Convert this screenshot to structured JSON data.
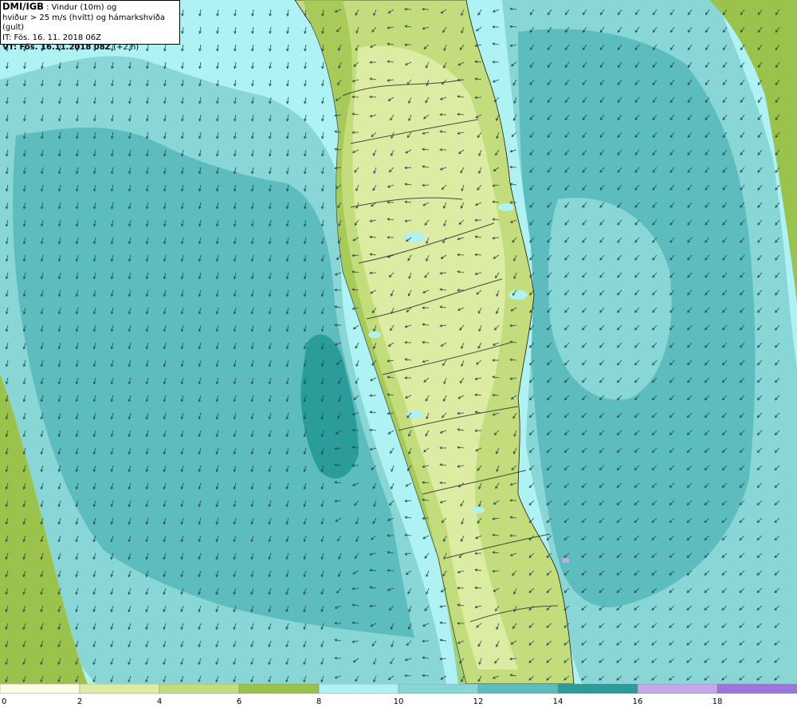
{
  "header": {
    "line1_bold": "DMI/IGB",
    "line1_rest": " : Vindur (10m) og",
    "line2": "hviður > 25 m/s (hvítt) og hámarkshviða (gult)",
    "line3": "IT: Fös. 16. 11. 2018 06Z",
    "line4_bold": "VT: Fös. 16.11.2018 08Z",
    "line4_rest": " (+2 h)"
  },
  "legend": {
    "colors": [
      "#fdfde6",
      "#dceca2",
      "#c3dd7c",
      "#9bc24a",
      "#aef2f4",
      "#88d6d6",
      "#5dbcbe",
      "#2a9c99",
      "#c3a9ea",
      "#9a76d8"
    ],
    "labels": [
      "0",
      "2",
      "4",
      "6",
      "8",
      "10",
      "12",
      "14",
      "16",
      "18"
    ]
  },
  "map": {
    "colors": {
      "ocean_light": "#aef2f4",
      "ocean_mid": "#88d6d6",
      "ocean_dark": "#5dbcbe",
      "ocean_deep": "#2a9c99",
      "land": "#c3dd7c",
      "land_dark": "#9bc24a",
      "land_light": "#dceca2"
    },
    "arrows": "wind-direction-arrows"
  }
}
